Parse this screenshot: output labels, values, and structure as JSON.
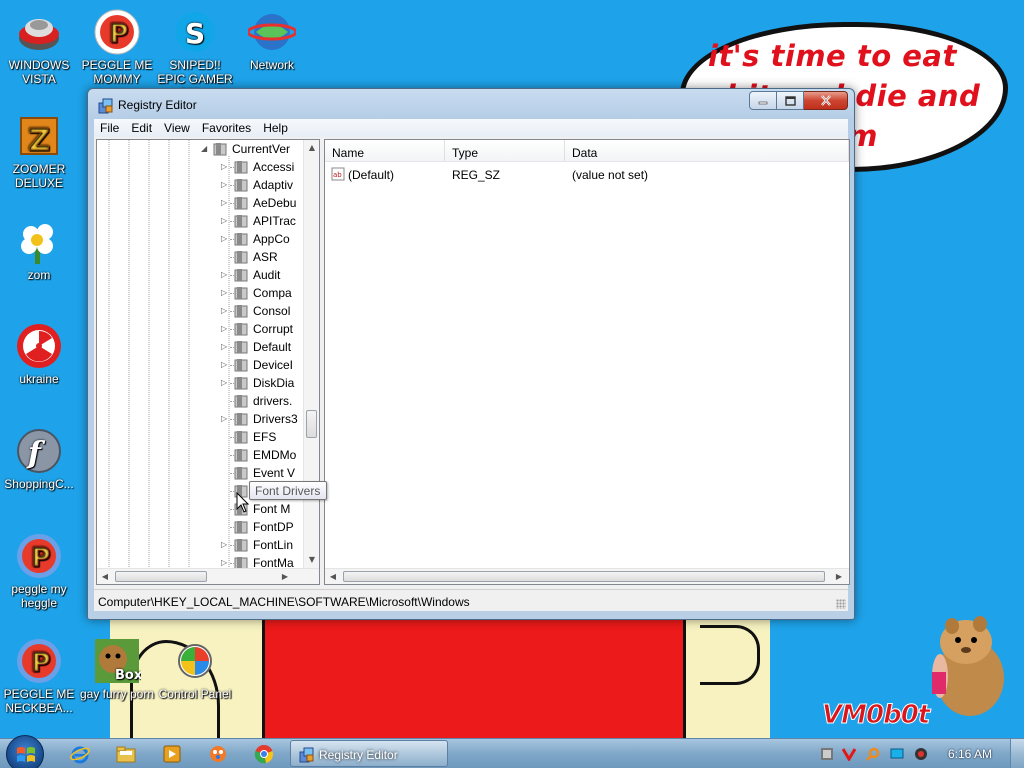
{
  "desktop": {
    "speech_text": "it's time to eat shit and die and chew gum",
    "vm_tag": "VM0b0t",
    "icons": [
      {
        "label": "WINDOWS VISTA",
        "icon": "vista-bowl-icon"
      },
      {
        "label": "PEGGLE ME MOMMY",
        "icon": "peggle-icon"
      },
      {
        "label": "SNIPED!! EPIC GAMER 360...",
        "icon": "skype-icon"
      },
      {
        "label": "Network",
        "icon": "network-icon"
      },
      {
        "label": "ZOOMER DELUXE",
        "icon": "zuma-icon"
      },
      {
        "label": "zom",
        "icon": "flower-icon"
      },
      {
        "label": "ukraine",
        "icon": "radiation-icon"
      },
      {
        "label": "ShoppingC...",
        "icon": "flash-icon"
      },
      {
        "label": "peggle my heggle",
        "icon": "peggle-icon"
      },
      {
        "label": "PEGGLE ME NECKBEA...",
        "icon": "peggle-icon"
      },
      {
        "label": "gay furry porn",
        "icon": "gopher-box-icon"
      },
      {
        "label": "Control Panel",
        "icon": "control-panel-icon"
      }
    ]
  },
  "window": {
    "title": "Registry Editor",
    "menu": [
      "File",
      "Edit",
      "View",
      "Favorites",
      "Help"
    ],
    "tree": {
      "parent": "CurrentVer",
      "items": [
        "Accessi",
        "Adaptiv",
        "AeDebu",
        "APITrac",
        "AppCo",
        "ASR",
        "Audit",
        "Compa",
        "Consol",
        "Corrupt",
        "Default",
        "DeviceI",
        "DiskDia",
        "drivers.",
        "Drivers3",
        "EFS",
        "EMDMo",
        "Event V",
        "Font Drivers",
        "Font M",
        "FontDP",
        "FontLin",
        "FontMa"
      ]
    },
    "list": {
      "columns": [
        "Name",
        "Type",
        "Data"
      ],
      "rows": [
        {
          "name": "(Default)",
          "type": "REG_SZ",
          "data": "(value not set)"
        }
      ]
    },
    "status": "Computer\\HKEY_LOCAL_MACHINE\\SOFTWARE\\Microsoft\\Windows",
    "tooltip": "Font Drivers"
  },
  "taskbar": {
    "task_label": "Registry Editor",
    "clock": "6:16 AM"
  },
  "colors": {
    "desktop_bg": "#1ea3ea",
    "speech_text": "#e0101c",
    "wall_red": "#ec1a1a",
    "wall_yellow": "#f7f2c0"
  }
}
